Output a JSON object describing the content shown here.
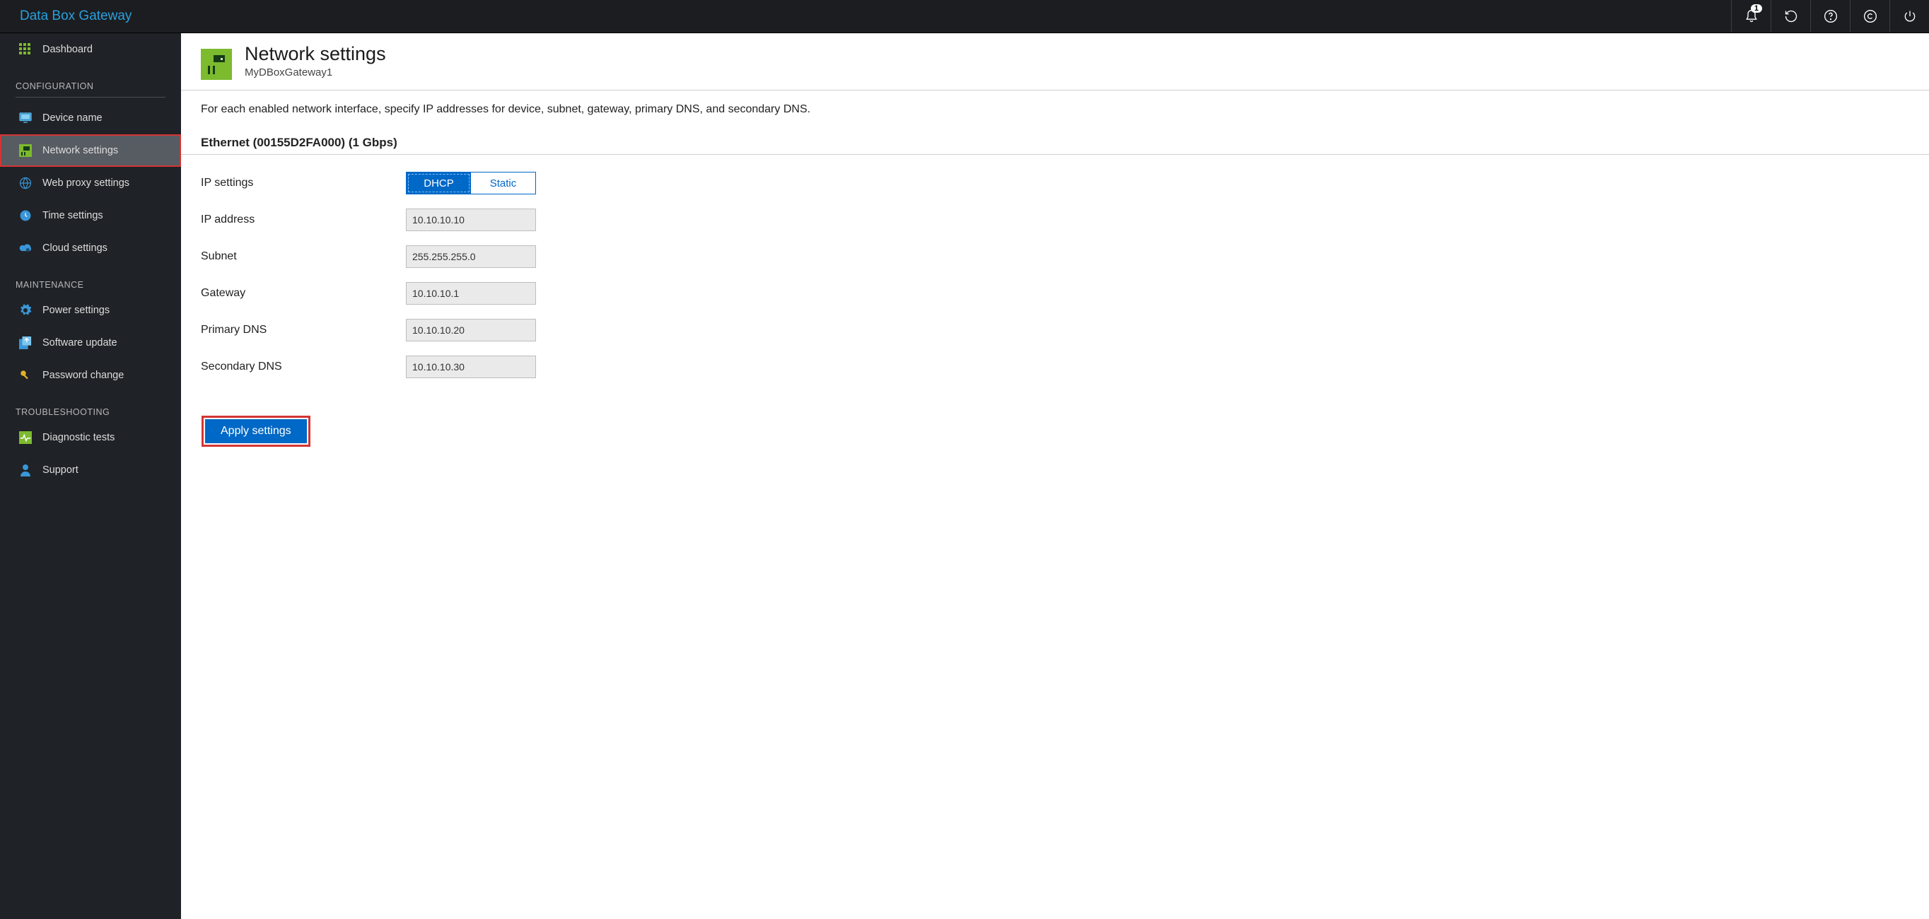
{
  "topbar": {
    "title": "Data Box Gateway",
    "notification_count": "1"
  },
  "sidebar": {
    "dashboard": "Dashboard",
    "section_configuration": "CONFIGURATION",
    "device_name": "Device name",
    "network_settings": "Network settings",
    "web_proxy": "Web proxy settings",
    "time_settings": "Time settings",
    "cloud_settings": "Cloud settings",
    "section_maintenance": "MAINTENANCE",
    "power_settings": "Power settings",
    "software_update": "Software update",
    "password_change": "Password change",
    "section_troubleshooting": "TROUBLESHOOTING",
    "diagnostic_tests": "Diagnostic tests",
    "support": "Support"
  },
  "page": {
    "title": "Network settings",
    "subtitle": "MyDBoxGateway1",
    "description": "For each enabled network interface, specify IP addresses for device, subnet, gateway, primary DNS, and secondary DNS.",
    "ethernet_heading": "Ethernet (00155D2FA000) (1 Gbps)"
  },
  "form": {
    "ip_settings_label": "IP settings",
    "toggle_dhcp": "DHCP",
    "toggle_static": "Static",
    "ip_address_label": "IP address",
    "ip_address_value": "10.10.10.10",
    "subnet_label": "Subnet",
    "subnet_value": "255.255.255.0",
    "gateway_label": "Gateway",
    "gateway_value": "10.10.10.1",
    "primary_dns_label": "Primary DNS",
    "primary_dns_value": "10.10.10.20",
    "secondary_dns_label": "Secondary DNS",
    "secondary_dns_value": "10.10.10.30",
    "apply_button": "Apply settings"
  }
}
